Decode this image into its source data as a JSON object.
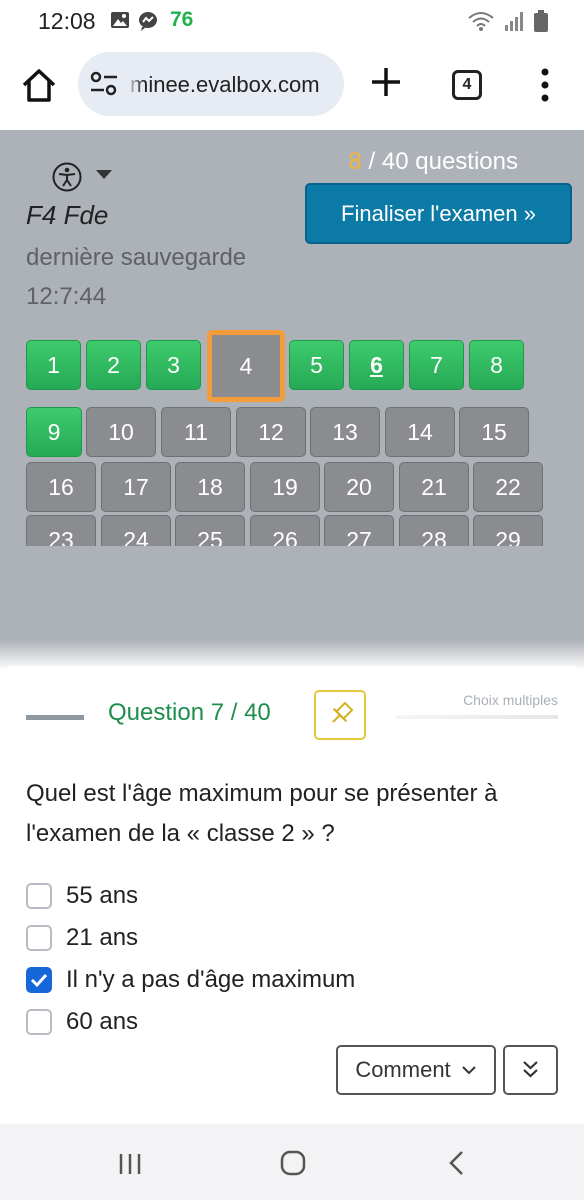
{
  "status_bar": {
    "time": "12:08",
    "notification_count": "76",
    "icons": [
      "image-icon",
      "messenger-icon",
      "wifi-icon",
      "signal-icon",
      "battery-icon"
    ]
  },
  "browser": {
    "url": "minee.evalbox.com",
    "tab_count": "4",
    "icons": [
      "home-icon",
      "site-settings-icon",
      "new-tab-icon",
      "tab-switcher-icon",
      "more-menu-icon"
    ]
  },
  "exam": {
    "candidate_name": "F4 Fde",
    "last_save_label": "dernière sauvegarde",
    "last_save_time": "12:7:44",
    "answered_count": "8",
    "total_label": " / 40 questions",
    "finalize_label": "Finaliser l'examen »",
    "colors": {
      "answered": "#2cb35c",
      "unanswered": "#8a8c90",
      "current_border": "#f49b3c",
      "finalize": "#0c7aa7"
    }
  },
  "question_grid": [
    {
      "n": "1",
      "state": "answered"
    },
    {
      "n": "2",
      "state": "answered"
    },
    {
      "n": "3",
      "state": "answered"
    },
    {
      "n": "4",
      "state": "current"
    },
    {
      "n": "5",
      "state": "answered"
    },
    {
      "n": "6",
      "state": "answered-active"
    },
    {
      "n": "7",
      "state": "answered"
    },
    {
      "n": "8",
      "state": "answered"
    },
    {
      "n": "9",
      "state": "answered"
    },
    {
      "n": "10",
      "state": "unanswered"
    },
    {
      "n": "11",
      "state": "unanswered"
    },
    {
      "n": "12",
      "state": "unanswered"
    },
    {
      "n": "13",
      "state": "unanswered"
    },
    {
      "n": "14",
      "state": "unanswered"
    },
    {
      "n": "15",
      "state": "unanswered"
    },
    {
      "n": "16",
      "state": "unanswered"
    },
    {
      "n": "17",
      "state": "unanswered"
    },
    {
      "n": "18",
      "state": "unanswered"
    },
    {
      "n": "19",
      "state": "unanswered"
    },
    {
      "n": "20",
      "state": "unanswered"
    },
    {
      "n": "21",
      "state": "unanswered"
    },
    {
      "n": "22",
      "state": "unanswered"
    },
    {
      "n": "23",
      "state": "unanswered"
    },
    {
      "n": "24",
      "state": "unanswered"
    },
    {
      "n": "25",
      "state": "unanswered"
    },
    {
      "n": "26",
      "state": "unanswered"
    },
    {
      "n": "27",
      "state": "unanswered"
    },
    {
      "n": "28",
      "state": "unanswered"
    },
    {
      "n": "29",
      "state": "unanswered"
    }
  ],
  "question": {
    "title": "Question 7 / 40",
    "type": "Choix multiples",
    "text": "Quel est l'âge maximum pour se présenter à l'examen de la « classe 2 » ?",
    "options": [
      {
        "label": "55 ans",
        "checked": false
      },
      {
        "label": "21 ans",
        "checked": false
      },
      {
        "label": "Il n'y a pas d'âge maximum",
        "checked": true
      },
      {
        "label": "60 ans",
        "checked": false
      }
    ],
    "comment_label": "Comment"
  }
}
